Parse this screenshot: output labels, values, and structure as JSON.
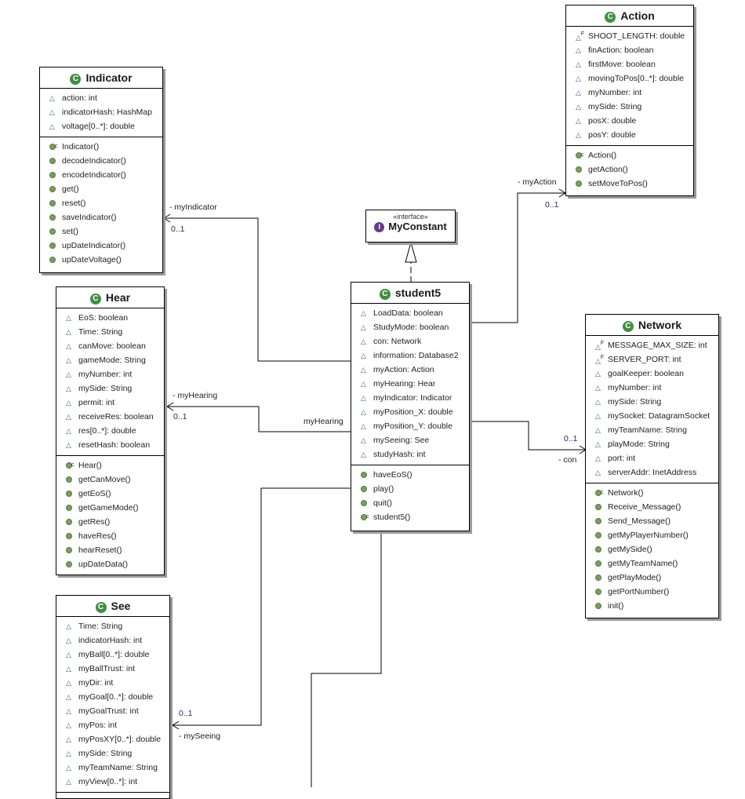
{
  "diagram": {
    "interface": {
      "stereotype": "«interface»",
      "name": "MyConstant",
      "icon": "interface-icon"
    },
    "classes": {
      "indicator": {
        "name": "Indicator",
        "attributes": [
          "action: int",
          "indicatorHash: HashMap",
          "voltage[0..*]: double"
        ],
        "operations": [
          "Indicator()",
          "decodeIndicator()",
          "encodeIndicator()",
          "get()",
          "reset()",
          "saveIndicator()",
          "set()",
          "upDateIndicator()",
          "upDateVoltage()"
        ]
      },
      "action": {
        "name": "Action",
        "attributes": [
          "SHOOT_LENGTH: double",
          "finAction: boolean",
          "firstMove: boolean",
          "movingToPos[0..*]: double",
          "myNumber: int",
          "mySide: String",
          "posX: double",
          "posY: double"
        ],
        "operations": [
          "Action()",
          "getAction()",
          "setMoveToPos()"
        ]
      },
      "student5": {
        "name": "student5",
        "attributes": [
          "LoadData: boolean",
          "StudyMode: boolean",
          "con: Network",
          "information: Database2",
          "myAction: Action",
          "myHearing: Hear",
          "myIndicator: Indicator",
          "myPosition_X: double",
          "myPosition_Y: double",
          "mySeeing: See",
          "studyHash: int"
        ],
        "operations": [
          "haveEoS()",
          "play()",
          "quit()",
          "student5()"
        ]
      },
      "hear": {
        "name": "Hear",
        "attributes": [
          "EoS: boolean",
          "Time: String",
          "canMove: boolean",
          "gameMode: String",
          "myNumber: int",
          "mySide: String",
          "permit: int",
          "receiveRes: boolean",
          "res[0..*]: double",
          "resetHash: boolean"
        ],
        "operations": [
          "Hear()",
          "getCanMove()",
          "getEoS()",
          "getGameMode()",
          "getRes()",
          "haveRes()",
          "hearReset()",
          "upDateData()"
        ]
      },
      "network": {
        "name": "Network",
        "attributes": [
          "MESSAGE_MAX_SIZE: int",
          "SERVER_PORT: int",
          "goalKeeper: boolean",
          "myNumber: int",
          "mySide: String",
          "mySocket: DatagramSocket",
          "myTeamName: String",
          "playMode: String",
          "port: int",
          "serverAddr: InetAddress"
        ],
        "operations": [
          "Network()",
          "Receive_Message()",
          "Send_Message()",
          "getMyPlayerNumber()",
          "getMySide()",
          "getMyTeamName()",
          "getPlayMode()",
          "getPortNumber()",
          "init()"
        ]
      },
      "see": {
        "name": "See",
        "attributes": [
          "Time: String",
          "indicatorHash: int",
          "myBall[0..*]: double",
          "myBallTrust: int",
          "myDir: int",
          "myGoal[0..*]: double",
          "myGoalTrust: int",
          "myPos: int",
          "myPosXY[0..*]: double",
          "mySide: String",
          "myTeamName: String",
          "myView[0..*]: int"
        ],
        "operations": []
      }
    },
    "modifiers": {
      "action": {
        "attributes": [
          "final",
          "",
          "",
          "",
          "",
          "",
          "",
          ""
        ],
        "operations": [
          "constructor",
          "",
          ""
        ]
      },
      "indicator": {
        "attributes": [
          "",
          "",
          ""
        ],
        "operations": [
          "constructor",
          "",
          "",
          "",
          "",
          "",
          "",
          "",
          ""
        ]
      },
      "student5": {
        "attributes": [
          "",
          "",
          "",
          "",
          "",
          "",
          "",
          "",
          "",
          "",
          ""
        ],
        "operations": [
          "",
          "",
          "",
          "constructor"
        ]
      },
      "hear": {
        "attributes": [
          "",
          "",
          "",
          "",
          "",
          "",
          "",
          "",
          "",
          ""
        ],
        "operations": [
          "constructor",
          "",
          "",
          "",
          "",
          "",
          "",
          ""
        ]
      },
      "network": {
        "attributes": [
          "final",
          "final",
          "",
          "",
          "",
          "",
          "",
          "",
          "",
          ""
        ],
        "operations": [
          "constructor",
          "",
          "",
          "",
          "",
          "",
          "",
          "",
          ""
        ]
      },
      "see": {
        "attributes": [
          "",
          "",
          "",
          "",
          "",
          "",
          "",
          "",
          "",
          "",
          "",
          ""
        ],
        "operations": []
      }
    },
    "associations": {
      "myIndicator": {
        "role": "- myIndicator",
        "multiplicity": "0..1"
      },
      "myHearing": {
        "role": "- myHearing",
        "multiplicity": "0..1",
        "source_label": "myHearing"
      },
      "myAction": {
        "role": "- myAction",
        "multiplicity": "0..1"
      },
      "con": {
        "role": "- con",
        "multiplicity": "0..1"
      },
      "mySeeing": {
        "role": "- mySeeing",
        "multiplicity": "0..1"
      }
    },
    "colors": {
      "class_icon": "#3f8f3f",
      "interface_icon": "#6a3a8a",
      "operation_dot": "#7a9f5a",
      "multiplicity_text": "#3a2060"
    }
  }
}
